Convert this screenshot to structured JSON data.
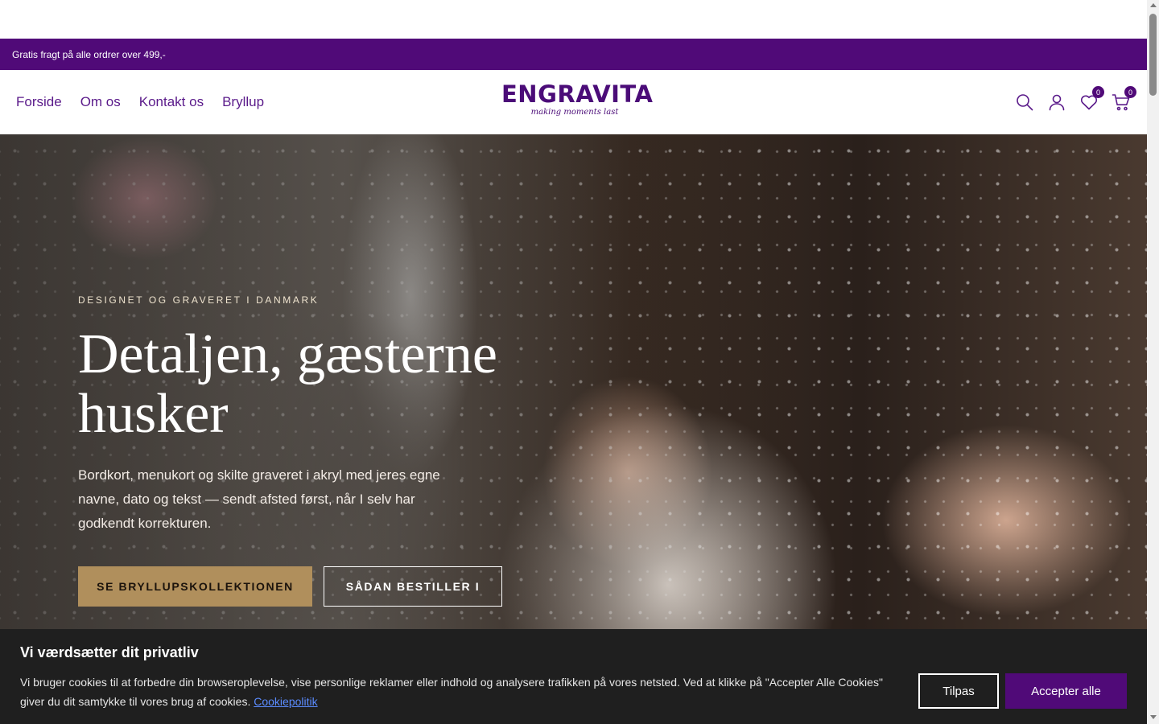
{
  "announcement": {
    "text": "Gratis fragt på alle ordrer over 499,-"
  },
  "nav": {
    "items": [
      {
        "label": "Forside"
      },
      {
        "label": "Om os"
      },
      {
        "label": "Kontakt os"
      },
      {
        "label": "Bryllup"
      }
    ]
  },
  "logo": {
    "word": "ENGRAVITA",
    "tagline": "making moments last"
  },
  "header_icons": {
    "search": "search-icon",
    "account": "user-icon",
    "wishlist": {
      "icon": "heart-icon",
      "count": "0"
    },
    "cart": {
      "icon": "cart-icon",
      "count": "0"
    }
  },
  "hero": {
    "eyebrow": "DESIGNET OG GRAVERET I DANMARK",
    "headline": "Detaljen, gæsterne husker",
    "body": "Bordkort, menukort og skilte graveret i akryl med jeres egne navne, dato og tekst — sendt afsted først, når I selv har godkendt korrekturen.",
    "primary_cta": "SE BRYLLUPSKOLLEKTIONEN",
    "secondary_cta": "SÅDAN BESTILLER I"
  },
  "cookie_banner": {
    "title": "Vi værdsætter dit privatliv",
    "text": "Vi bruger cookies til at forbedre din browseroplevelse, vise personlige reklamer eller indhold og analysere trafikken på vores netsted. Ved at klikke på \"Accepter Alle Cookies\" giver du dit samtykke til vores brug af cookies.",
    "link": "Cookiepolitik",
    "customize": "Tilpas",
    "accept": "Accepter alle"
  },
  "colors": {
    "brand": "#500a78",
    "gold": "#b08f5c",
    "banner_bg": "#1f1f1f"
  }
}
